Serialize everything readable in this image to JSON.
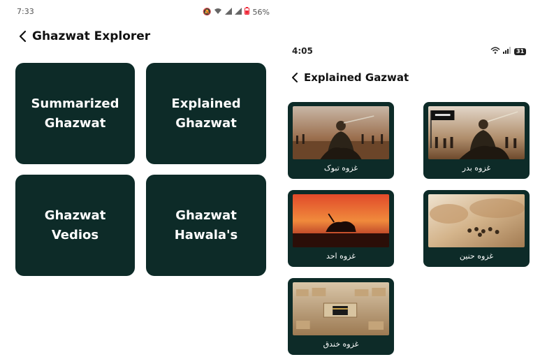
{
  "left_screen": {
    "status_bar": {
      "time": "7:33",
      "battery": "56%"
    },
    "app_bar": {
      "title": "Ghazwat Explorer"
    },
    "tiles": [
      {
        "label": "Summarized\nGhazwat"
      },
      {
        "label": "Explained\nGhazwat"
      },
      {
        "label": "Ghazwat\nVedios"
      },
      {
        "label": "Ghazwat\nHawala's"
      }
    ]
  },
  "right_screen": {
    "status_bar": {
      "time": "4:05",
      "battery": "31"
    },
    "app_bar": {
      "title": "Explained Gazwat"
    },
    "cards": [
      {
        "label": "غزوه تبوک",
        "image": "battle-horseman-image"
      },
      {
        "label": "غزوه بدر",
        "image": "battle-army-image"
      },
      {
        "label": "غزوه احد",
        "image": "sunset-horseman-image"
      },
      {
        "label": "غزوه حنین",
        "image": "desert-battle-image"
      },
      {
        "label": "غزوه خندق",
        "image": "city-kaaba-image"
      }
    ]
  },
  "colors": {
    "tile_bg": "#0d2b28",
    "tile_text": "#ffffff",
    "title_text": "#111111"
  },
  "icons": [
    "chevron-left-icon",
    "wifi-icon",
    "signal-icon",
    "battery-icon"
  ]
}
